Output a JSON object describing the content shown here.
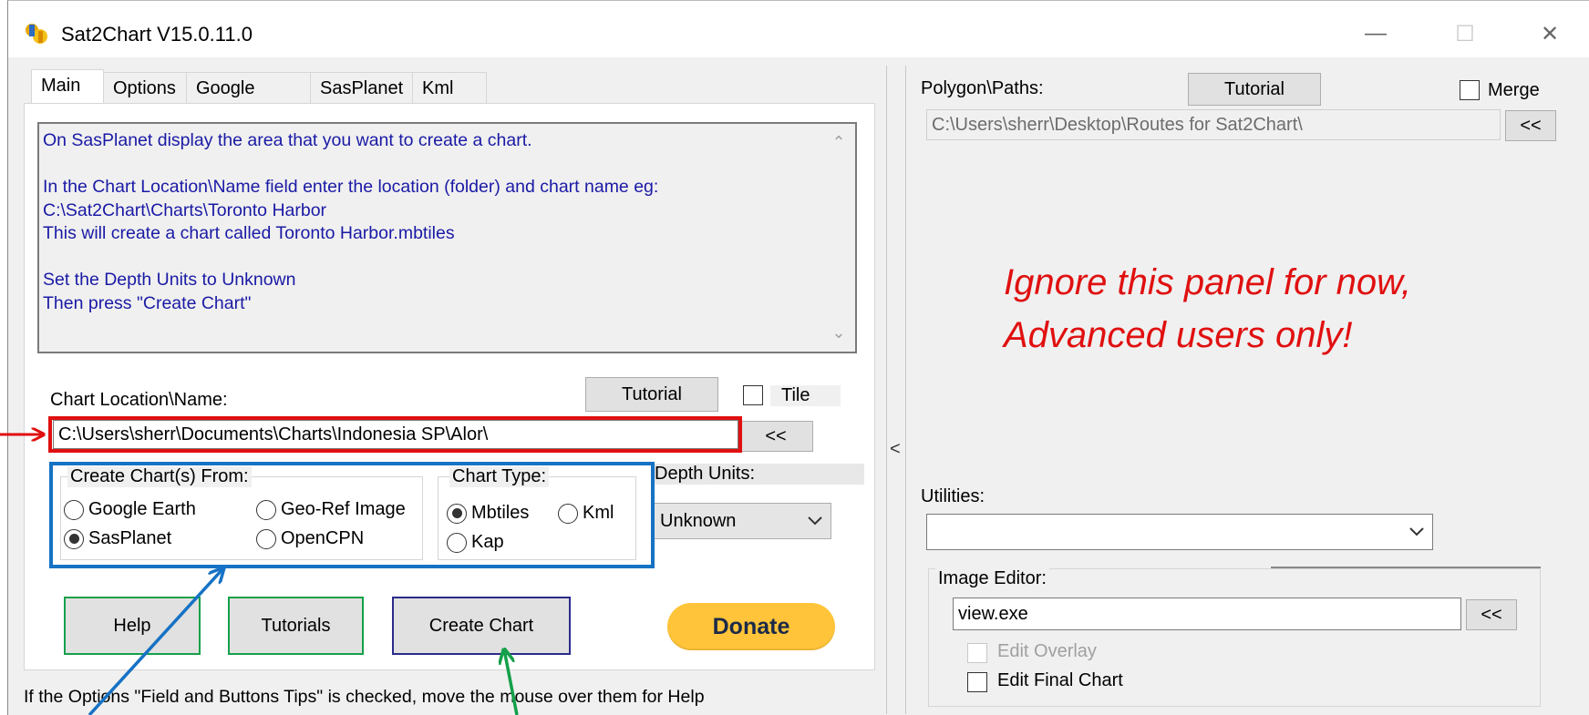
{
  "window": {
    "title": "Sat2Chart V15.0.11.0",
    "controls": {
      "minimize": "—",
      "maximize": "☐",
      "close": "✕"
    }
  },
  "tabs": [
    {
      "label": "Main",
      "active": true
    },
    {
      "label": "Options",
      "active": false
    },
    {
      "label": "Google earth",
      "active": false
    },
    {
      "label": "SasPlanet",
      "active": false
    },
    {
      "label": "Kml",
      "active": false
    }
  ],
  "instructions": {
    "lines": [
      "On SasPlanet display the area that you want to create a chart.",
      "",
      "In the Chart Location\\Name field enter the location (folder) and chart name eg:",
      "C:\\Sat2Chart\\Charts\\Toronto Harbor",
      "This will create a chart called Toronto Harbor.mbtiles",
      "",
      "Set the Depth Units to Unknown",
      "Then press \"Create Chart\""
    ]
  },
  "chart_location": {
    "label": "Chart Location\\Name:",
    "value": "C:\\Users\\sherr\\Documents\\Charts\\Indonesia SP\\Alor\\",
    "browse_label": "<<",
    "tutorial_label": "Tutorial",
    "tile_label": "Tile"
  },
  "create_from": {
    "title": "Create Chart(s) From:",
    "options": [
      {
        "label": "Google Earth",
        "selected": false
      },
      {
        "label": "Geo-Ref Image",
        "selected": false
      },
      {
        "label": "SasPlanet",
        "selected": true
      },
      {
        "label": "OpenCPN",
        "selected": false
      }
    ]
  },
  "chart_type": {
    "title": "Chart Type:",
    "options": [
      {
        "label": "Mbtiles",
        "selected": true
      },
      {
        "label": "Kml",
        "selected": false
      },
      {
        "label": "Kap",
        "selected": false
      }
    ]
  },
  "depth_units": {
    "label": "Depth Units:",
    "value": "Unknown"
  },
  "buttons": {
    "help": "Help",
    "tutorials": "Tutorials",
    "create_chart": "Create Chart",
    "donate": "Donate"
  },
  "status_tip": "If the Options \"Field and Buttons Tips\" is checked, move the mouse over them for Help",
  "right_panel": {
    "polygon_label": "Polygon\\Paths:",
    "tutorial_label": "Tutorial",
    "merge_label": "Merge",
    "polygon_path": "C:\\Users\\sherr\\Desktop\\Routes for Sat2Chart\\",
    "browse_label": "<<",
    "utilities_label": "Utilities:",
    "utilities_value": "",
    "image_editor": {
      "title": "Image Editor:",
      "value": "view.exe",
      "browse_label": "<<",
      "edit_overlay_label": "Edit Overlay",
      "edit_final_label": "Edit Final Chart"
    }
  },
  "splitter_glyph": "<",
  "annotation": {
    "line1": "Ignore this panel for now,",
    "line2": "Advanced users only!"
  },
  "colors": {
    "red_highlight": "#e01010",
    "blue_highlight": "#1672c4",
    "green_highlight": "#14a04a",
    "info_text": "#1a1aa6",
    "donate": "#ffc439"
  }
}
